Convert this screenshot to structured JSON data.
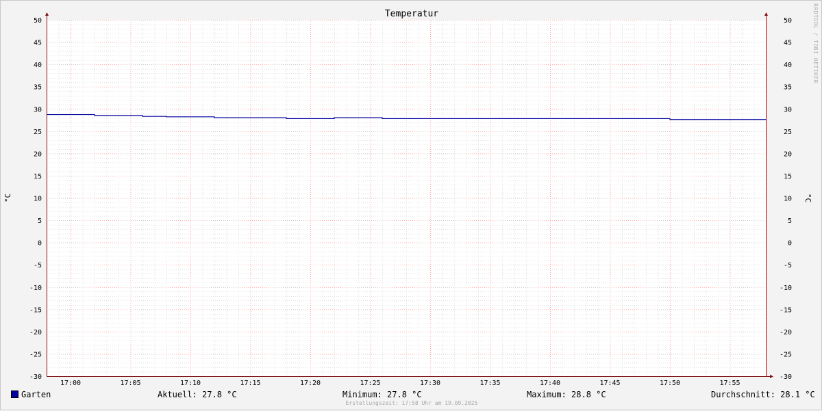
{
  "chart_data": {
    "type": "line",
    "title": "Temperatur",
    "ylabel": "°C",
    "y2label": "°C",
    "ylim": [
      -30,
      50
    ],
    "yticks": [
      50,
      45,
      40,
      35,
      30,
      25,
      20,
      15,
      10,
      5,
      0,
      -5,
      -10,
      -15,
      -20,
      -25,
      -30
    ],
    "xlim": [
      "16:58",
      "17:58"
    ],
    "xticks": [
      "17:00",
      "17:05",
      "17:10",
      "17:15",
      "17:20",
      "17:25",
      "17:30",
      "17:35",
      "17:40",
      "17:45",
      "17:50",
      "17:55"
    ],
    "grid": true,
    "series": [
      {
        "name": "Garten",
        "color": "#0000a0",
        "x": [
          "16:58",
          "17:00",
          "17:02",
          "17:04",
          "17:06",
          "17:08",
          "17:10",
          "17:12",
          "17:14",
          "17:16",
          "17:18",
          "17:20",
          "17:22",
          "17:26",
          "17:30",
          "17:40",
          "17:48",
          "17:50",
          "17:56",
          "17:58"
        ],
        "values": [
          28.8,
          28.8,
          28.6,
          28.6,
          28.4,
          28.3,
          28.3,
          28.1,
          28.1,
          28.1,
          27.9,
          27.9,
          28.1,
          27.9,
          27.9,
          27.9,
          27.9,
          27.7,
          27.7,
          27.6
        ]
      }
    ]
  },
  "legend": {
    "series_name": "Garten",
    "aktuell": "Aktuell: 27.8 °C",
    "minimum": "Minimum: 27.8 °C",
    "maximum": "Maximum: 28.8 °C",
    "durchschnitt": "Durchschnitt: 28.1 °C"
  },
  "watermark": "RRDTOOL / TOBI OETIKER",
  "footer": "Erstellungszeit: 17:58 Uhr am 19.09.2025",
  "colors": {
    "background": "#f3f3f3",
    "plot": "#ffffff",
    "major_grid": "#e8a0a0",
    "minor_grid": "#c8c8c8",
    "axis": "#7a1010",
    "series": "#0000a0"
  }
}
